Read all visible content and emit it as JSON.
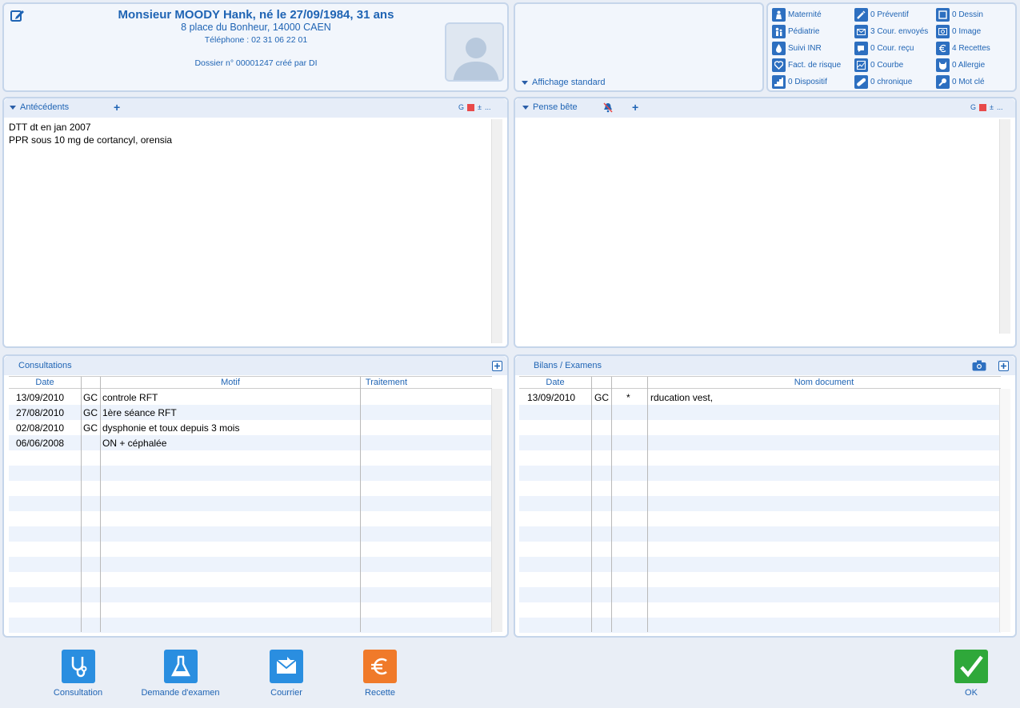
{
  "patient": {
    "name": "Monsieur MOODY Hank, né le 27/09/1984, 31 ans",
    "address": "8 place du Bonheur, 14000 CAEN",
    "phone": "Téléphone : 02 31 06 22 01",
    "dossier": "Dossier n° 00001247 créé par DI"
  },
  "view": {
    "label": "Affichage standard"
  },
  "counters": {
    "col1": [
      "Maternité",
      "Pédiatrie",
      "Suivi INR",
      "Fact. de risque",
      "0 Dispositif"
    ],
    "col2": [
      "0 Préventif",
      "3 Cour. envoyés",
      "0 Cour. reçu",
      "0 Courbe",
      "0 chronique"
    ],
    "col3": [
      "0 Dessin",
      "0 Image",
      "4 Recettes",
      "0 Allergie",
      "0 Mot clé"
    ]
  },
  "antecedents": {
    "title": "Antécédents",
    "tools": {
      "g": "G",
      "pm": "±",
      "more": "..."
    },
    "lines": [
      "DTT dt en jan 2007",
      "PPR sous 10 mg de cortancyl, orensia"
    ]
  },
  "pense": {
    "title": "Pense bête",
    "tools": {
      "g": "G",
      "pm": "±",
      "more": "..."
    }
  },
  "consultations": {
    "title": "Consultations",
    "columns": {
      "date": "Date",
      "motif": "Motif",
      "traitement": "Traitement"
    },
    "rows": [
      {
        "date": "13/09/2010",
        "code": "GC",
        "motif": "controle RFT",
        "traitement": ""
      },
      {
        "date": "27/08/2010",
        "code": "GC",
        "motif": "1ère séance RFT",
        "traitement": ""
      },
      {
        "date": "02/08/2010",
        "code": "GC",
        "motif": "dysphonie et toux depuis 3 mois",
        "traitement": ""
      },
      {
        "date": "06/06/2008",
        "code": "",
        "motif": "ON + céphalée",
        "traitement": ""
      }
    ]
  },
  "bilans": {
    "title": "Bilans / Examens",
    "columns": {
      "date": "Date",
      "nom": "Nom document"
    },
    "rows": [
      {
        "date": "13/09/2010",
        "code": "GC",
        "mark": "*",
        "nom": "rducation vest,"
      }
    ]
  },
  "buttons": {
    "consultation": "Consultation",
    "demande": "Demande d'examen",
    "courrier": "Courrier",
    "recette": "Recette",
    "ok": "OK"
  },
  "colors": {
    "accent": "#1f64b4",
    "button_blue": "#2a8ee0",
    "button_orange": "#f07a2a",
    "button_green": "#2fa83a"
  }
}
